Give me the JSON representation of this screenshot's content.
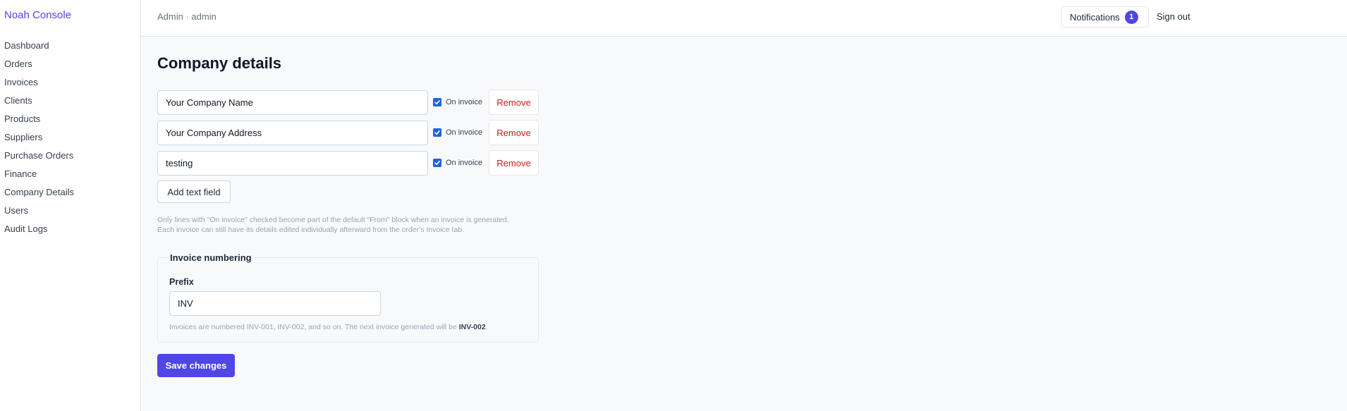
{
  "app": {
    "brand": "Noah Console"
  },
  "sidebar": {
    "items": [
      {
        "label": "Dashboard"
      },
      {
        "label": "Orders"
      },
      {
        "label": "Invoices"
      },
      {
        "label": "Clients"
      },
      {
        "label": "Products"
      },
      {
        "label": "Suppliers"
      },
      {
        "label": "Purchase Orders"
      },
      {
        "label": "Finance"
      },
      {
        "label": "Company Details"
      },
      {
        "label": "Users"
      },
      {
        "label": "Audit Logs"
      }
    ]
  },
  "header": {
    "breadcrumb": "Admin · admin",
    "notifications_label": "Notifications",
    "notifications_count": "1",
    "signout_label": "Sign out"
  },
  "page": {
    "title": "Company details",
    "fields": [
      {
        "value": "Your Company Name",
        "on_invoice": true,
        "checkbox_label": "On invoice",
        "remove_label": "Remove"
      },
      {
        "value": "Your Company Address",
        "on_invoice": true,
        "checkbox_label": "On invoice",
        "remove_label": "Remove"
      },
      {
        "value": "testing",
        "on_invoice": true,
        "checkbox_label": "On invoice",
        "remove_label": "Remove"
      }
    ],
    "add_field_label": "Add text field",
    "help_line1": "Only lines with \"On invoice\" checked become part of the default \"From\" block when an invoice is generated.",
    "help_line2": "Each invoice can still have its details edited individually afterward from the order's Invoice tab."
  },
  "numbering": {
    "legend": "Invoice numbering",
    "prefix_label": "Prefix",
    "prefix_value": "INV",
    "note_prefix": "Invoices are numbered INV-001, INV-002, and so on. The next invoice generated will be ",
    "next_number": "INV-002",
    "note_suffix": "."
  },
  "save_label": "Save changes",
  "colors": {
    "accent": "#4f46e5",
    "danger": "#c81e1e",
    "checkbox": "#1d64d8"
  }
}
